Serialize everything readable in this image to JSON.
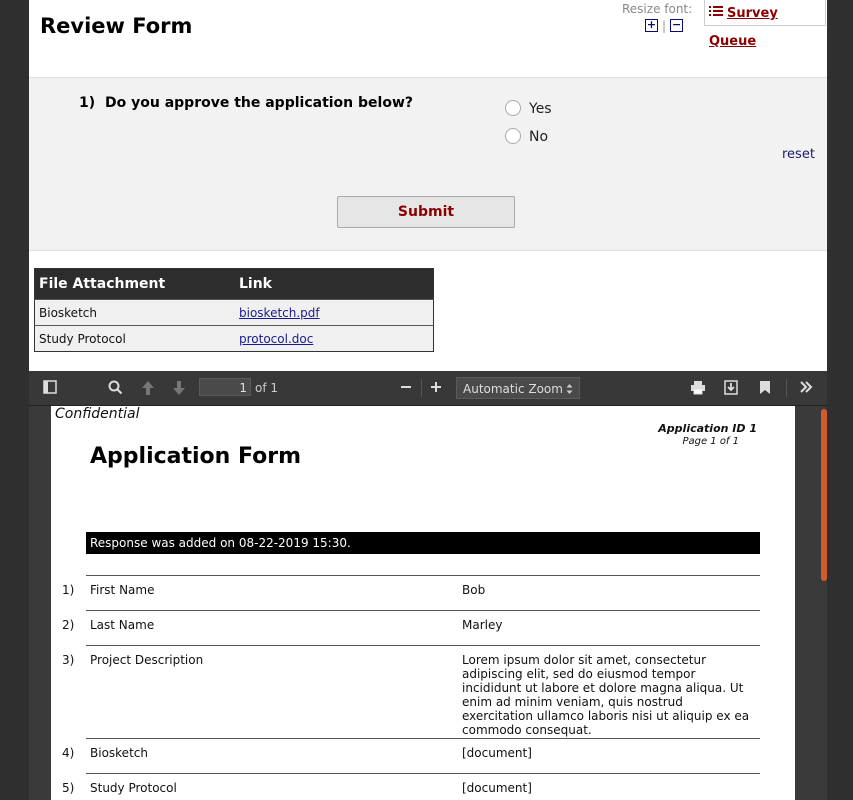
{
  "header": {
    "title": "Review Form",
    "resize_font_label": "Resize font:",
    "increase_icon": "+",
    "decrease_icon": "−",
    "separator": "|",
    "survey_queue_label": "Survey Queue",
    "survey_queue_icon": "list-check-icon"
  },
  "question": {
    "number": "1)",
    "text": "Do you approve the application below?",
    "options": [
      {
        "label": "Yes"
      },
      {
        "label": "No"
      }
    ],
    "reset_label": "reset"
  },
  "submit_label": "Submit",
  "attachments": {
    "headers": [
      "File Attachment",
      "Link"
    ],
    "rows": [
      {
        "name": "Biosketch",
        "link": "biosketch.pdf"
      },
      {
        "name": "Study Protocol",
        "link": "protocol.doc"
      }
    ]
  },
  "viewer": {
    "page_number": "1",
    "page_count_label": "of 1",
    "zoom_label": "Automatic Zoom",
    "zoom_arrow": "▲▼"
  },
  "pdf": {
    "confidential": "Confidential",
    "application_id": "Application ID 1",
    "page_label": "Page 1 of 1",
    "title": "Application Form",
    "response_text": "Response was added on 08-22-2019 15:30.",
    "rows": [
      {
        "num": "1)",
        "label": "First Name",
        "value": "Bob"
      },
      {
        "num": "2)",
        "label": "Last Name",
        "value": "Marley"
      },
      {
        "num": "3)",
        "label": "Project Description",
        "value": "Lorem ipsum dolor sit amet, consectetur adipiscing elit, sed do eiusmod tempor incididunt ut labore et dolore magna aliqua. Ut enim ad minim veniam, quis nostrud exercitation ullamco laboris nisi ut aliquip ex ea commodo consequat."
      },
      {
        "num": "4)",
        "label": "Biosketch",
        "value": "[document]"
      },
      {
        "num": "5)",
        "label": "Study Protocol",
        "value": "[document]"
      }
    ]
  }
}
